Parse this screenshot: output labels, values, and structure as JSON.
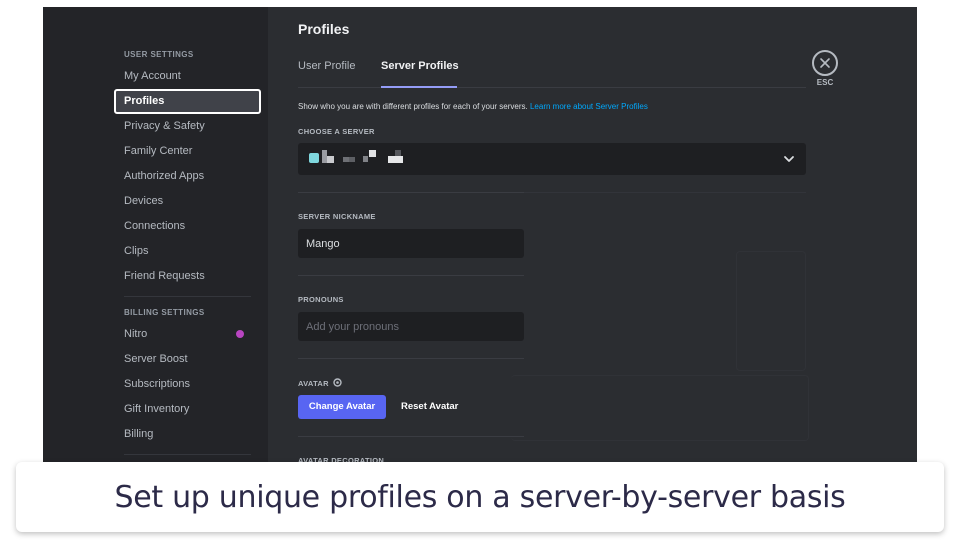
{
  "sidebar": {
    "user_settings_header": "User Settings",
    "user_items": [
      {
        "label": "My Account"
      },
      {
        "label": "Profiles",
        "active": true
      },
      {
        "label": "Privacy & Safety"
      },
      {
        "label": "Family Center"
      },
      {
        "label": "Authorized Apps"
      },
      {
        "label": "Devices"
      },
      {
        "label": "Connections"
      },
      {
        "label": "Clips"
      },
      {
        "label": "Friend Requests"
      }
    ],
    "billing_settings_header": "Billing Settings",
    "billing_items": [
      {
        "label": "Nitro",
        "badge_icon": "nitro-badge-icon"
      },
      {
        "label": "Server Boost"
      },
      {
        "label": "Subscriptions"
      },
      {
        "label": "Gift Inventory"
      },
      {
        "label": "Billing"
      }
    ]
  },
  "main": {
    "title": "Profiles",
    "tabs": [
      {
        "label": "User Profile",
        "active": false
      },
      {
        "label": "Server Profiles",
        "active": true
      }
    ],
    "description": "Show who you are with different profiles for each of your servers.",
    "learn_more_link": "Learn more about Server Profiles",
    "choose_server_label": "Choose a Server",
    "choose_server_value": "(obscured server name)",
    "server_nickname_label": "Server Nickname",
    "server_nickname_value": "Mango",
    "pronouns_label": "Pronouns",
    "pronouns_placeholder": "Add your pronouns",
    "avatar_label": "Avatar",
    "change_avatar_button": "Change Avatar",
    "reset_avatar_button": "Reset Avatar",
    "avatar_decoration_label": "Avatar Decoration",
    "close_label": "ESC"
  },
  "colors": {
    "accent": "#5865f2",
    "link": "#00a8fc",
    "tab_underline": "#949cf7",
    "nitro_badge": "#b845c1"
  },
  "caption": {
    "text": "Set up unique profiles on a server-by-server basis"
  }
}
